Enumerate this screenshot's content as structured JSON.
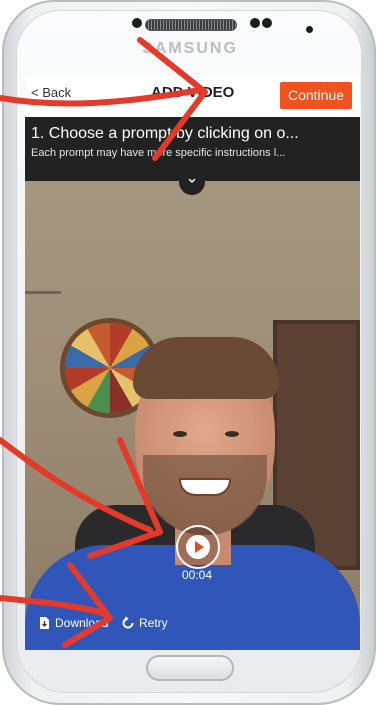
{
  "device": {
    "brand": "SAMSUNG"
  },
  "topbar": {
    "back_label": "< Back",
    "title": "ADD VIDEO",
    "continue_label": "Continue"
  },
  "prompt": {
    "title": "1. Choose a prompt by clicking on o...",
    "subtitle": "Each prompt may have more specific instructions l...",
    "expand_icon": "chevron-down-icon"
  },
  "video": {
    "duration": "00:04",
    "play_icon": "play-icon"
  },
  "actions": {
    "download_label": "Download",
    "retry_label": "Retry",
    "download_icon": "download-file-icon",
    "retry_icon": "retry-icon"
  },
  "colors": {
    "accent": "#f4511e",
    "annotation": "#e53a2a",
    "prompt_bg": "#222222"
  }
}
